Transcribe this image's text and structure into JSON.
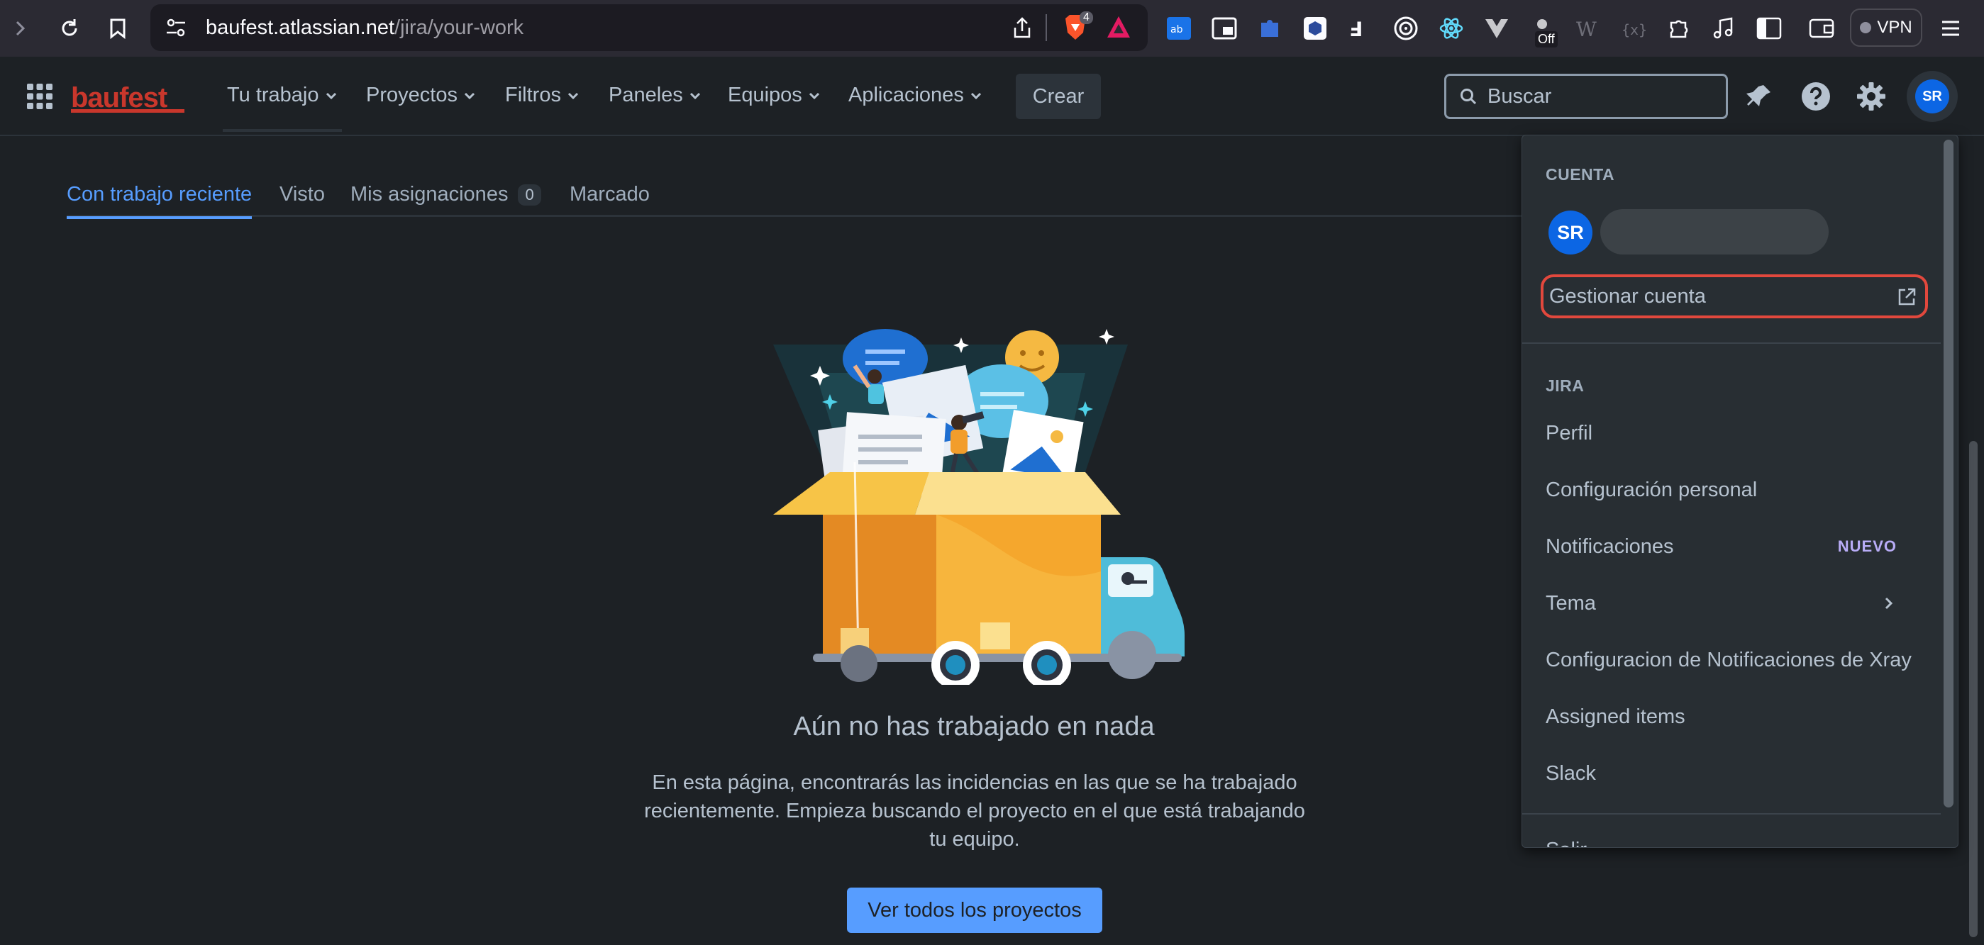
{
  "browser": {
    "url_host": "baufest.atlassian.net",
    "url_path": "/jira/your-work",
    "brave_badge": "4",
    "off_label": "Off",
    "vpn_label": "VPN"
  },
  "header": {
    "logo_text": "baufest",
    "nav": [
      {
        "label": "Tu trabajo"
      },
      {
        "label": "Proyectos"
      },
      {
        "label": "Filtros"
      },
      {
        "label": "Paneles"
      },
      {
        "label": "Equipos"
      },
      {
        "label": "Aplicaciones"
      }
    ],
    "create_label": "Crear",
    "search_placeholder": "Buscar",
    "avatar_initials": "SR"
  },
  "tabs": [
    {
      "label": "Con trabajo reciente",
      "selected": true
    },
    {
      "label": "Visto"
    },
    {
      "label": "Mis asignaciones",
      "count": "0"
    },
    {
      "label": "Marcado"
    }
  ],
  "empty_state": {
    "title": "Aún no has trabajado en nada",
    "body": "En esta página, encontrarás las incidencias en las que se ha trabajado recientemente. Empieza buscando el proyecto en el que está trabajando tu equipo.",
    "button": "Ver todos los proyectos"
  },
  "account_menu": {
    "account_section": "CUENTA",
    "avatar_initials": "SR",
    "manage_account": "Gestionar cuenta",
    "jira_section": "JIRA",
    "items": [
      {
        "label": "Perfil"
      },
      {
        "label": "Configuración personal"
      },
      {
        "label": "Notificaciones",
        "badge": "NUEVO"
      },
      {
        "label": "Tema"
      },
      {
        "label": "Configuracion de Notificaciones de Xray"
      },
      {
        "label": "Assigned items"
      },
      {
        "label": "Slack"
      }
    ],
    "logout_partial": "Salir"
  },
  "colors": {
    "background": "#1d2125",
    "accent": "#579dff",
    "avatar": "#0c66e4",
    "highlight_outline": "#e2483d",
    "logo": "#c9372c",
    "new_badge": "#b8acf6"
  }
}
